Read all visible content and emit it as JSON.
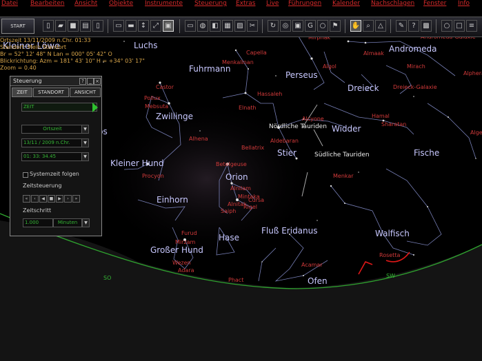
{
  "menu": [
    "Datei",
    "Bearbeiten",
    "Ansicht",
    "Objekte",
    "Instrumente",
    "Steuerung",
    "Extras",
    "Live",
    "Führungen",
    "Kalender",
    "Nachschlagen",
    "Fenster",
    "Info"
  ],
  "toolbar": {
    "start_label": "START"
  },
  "info_lines": [
    "Ortszeit 13/11/2009 n.Chr. 01:33",
    "Standort: Mein Standort",
    "Br = 52° 12' 48\" N  Lan = 000° 05' 42\" O",
    "Blickrichtung: Azm = 181° 43' 10\"  H = +34° 03' 17\"",
    "Zoom = 0.40"
  ],
  "panel": {
    "title": "Steuerung",
    "tabs": [
      "ZEIT",
      "STANDORT",
      "ANSICHT"
    ],
    "time_label": "ZEIT",
    "time_mode": "Ortszeit",
    "date": "13/11 / 2009  n.Chr.",
    "time": "01: 33: 34.45",
    "system_time_label": "Systemzeit folgen",
    "time_control_label": "Zeitsteuerung",
    "step_label": "Zeitschritt",
    "step_value": "1.000",
    "step_unit": "Minuten"
  },
  "constellations": [
    "Kleiner Löwe",
    "Luchs",
    "Andromeda",
    "Fuhrmann",
    "Perseus",
    "Dreieck",
    "Zwillinge",
    "Widder",
    "Krebs",
    "Stier",
    "Fische",
    "Kleiner Hund",
    "Orion",
    "Einhorn",
    "Fluß Eridanus",
    "Walfisch",
    "Hase",
    "Großer Hund",
    "Ofen"
  ],
  "stars": [
    "Mirphak",
    "Andromeda-Galaxie",
    "Almaak",
    "Algol",
    "Mirach",
    "Capella",
    "Menkalinan",
    "Hassaleh",
    "Castor",
    "Pollux",
    "Elnath",
    "Mebsuta",
    "Alhena",
    "Dreieck-Galaxie",
    "Hamal",
    "Sharatan",
    "Alcyone",
    "Aldebaran",
    "Bellatrix",
    "Procyon",
    "Betelgeuse",
    "Menkar",
    "Alnilam",
    "Mintaka",
    "Alnitak",
    "Rigel",
    "Saiph",
    "Cursa",
    "Furud",
    "Mirzam",
    "Wezen",
    "Adara",
    "Phact",
    "Acamar",
    "Rosetta",
    "Alpheratz",
    "Algenib"
  ],
  "showers": [
    "Nördliche Tauriden",
    "Südliche Tauriden"
  ],
  "cardinal": [
    "SO",
    "SW"
  ]
}
